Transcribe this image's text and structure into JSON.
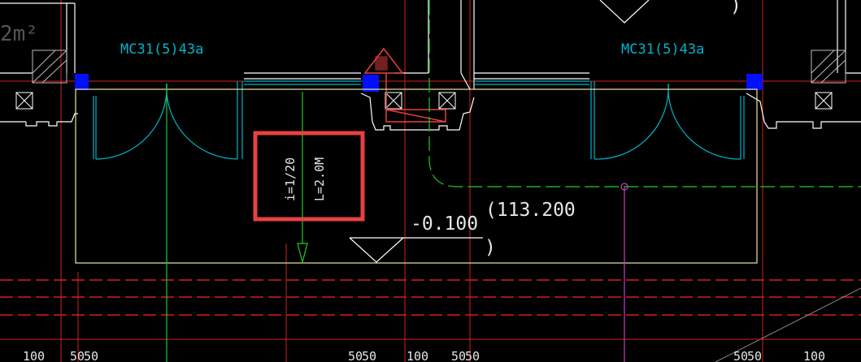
{
  "drawing": {
    "room_area_fragment": "2m²",
    "door_tags": [
      "MC31(5)43a",
      "MC31(5)43a"
    ],
    "slope_note": {
      "slope": "i=1/20",
      "length": "L=2.0M"
    },
    "floor_level": "-0.100",
    "absolute_level": "(113.200",
    "level_bracket_close": ")",
    "top_bracket": ")",
    "dimension_labels": [
      "100",
      "50",
      "50",
      "50",
      "50",
      "100",
      "50",
      "50",
      "50",
      "50",
      "100"
    ]
  },
  "colors": {
    "background": "#000000",
    "wall": "#ffffff",
    "door": "#00b4c8",
    "axis_red": "#d22020",
    "pipe_green": "#22cc22",
    "ramp": "#f0e6a0",
    "marker_blue": "#0010ff",
    "highlight": "#e84040",
    "magenta": "#c040c0"
  },
  "icons": [
    "column-marker-icon",
    "column-cross-icon",
    "fire-hydrant-icon",
    "level-triangle-icon",
    "slope-arrow-icon"
  ]
}
